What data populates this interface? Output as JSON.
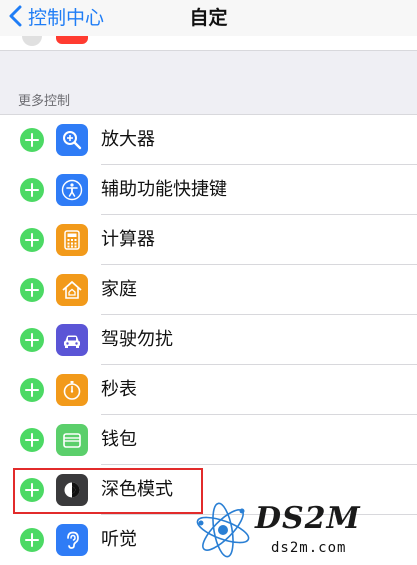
{
  "navbar": {
    "back_label": "控制中心",
    "title": "自定"
  },
  "section": {
    "header": "更多控制"
  },
  "controls": [
    {
      "label": "放大器",
      "icon": "magnifier-icon",
      "color": "#2f7cf6"
    },
    {
      "label": "辅助功能快捷键",
      "icon": "accessibility-icon",
      "color": "#2f7cf6"
    },
    {
      "label": "计算器",
      "icon": "calculator-icon",
      "color": "#f29a1a"
    },
    {
      "label": "家庭",
      "icon": "home-icon",
      "color": "#f29a1a"
    },
    {
      "label": "驾驶勿扰",
      "icon": "car-icon",
      "color": "#5b55d6"
    },
    {
      "label": "秒表",
      "icon": "stopwatch-icon",
      "color": "#f29a1a"
    },
    {
      "label": "钱包",
      "icon": "wallet-icon",
      "color": "#5bcf6b"
    },
    {
      "label": "深色模式",
      "icon": "dark-mode-icon",
      "color": "#3a3a3c"
    },
    {
      "label": "听觉",
      "icon": "ear-icon",
      "color": "#2f7cf6"
    }
  ],
  "watermark": {
    "logo": "DS2M",
    "url": "ds2m.com"
  }
}
